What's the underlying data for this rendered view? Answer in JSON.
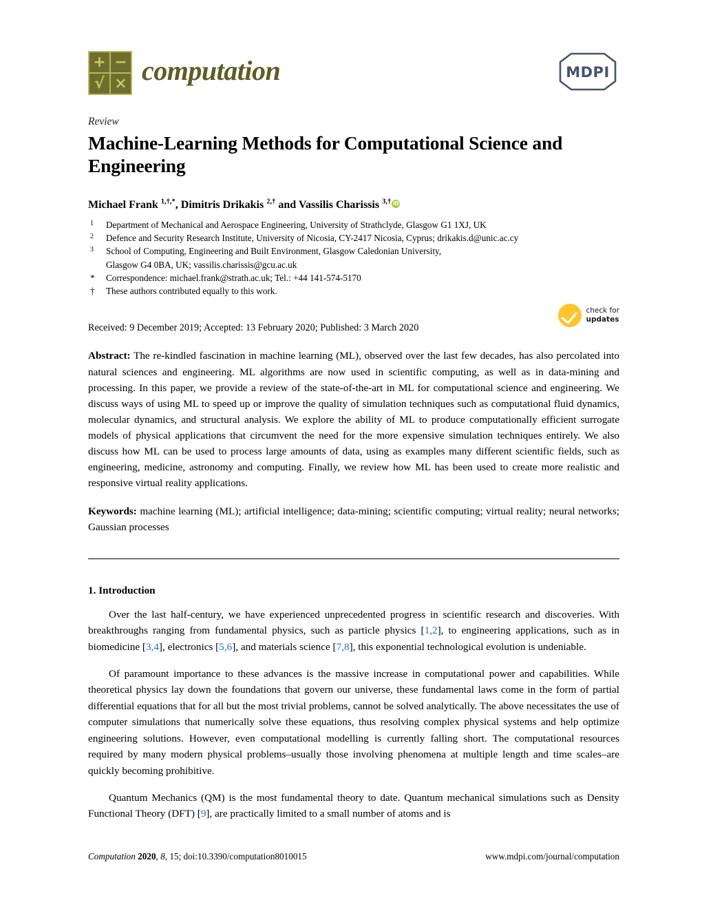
{
  "masthead": {
    "journal_name": "computation",
    "logo_cells": [
      "+",
      "−",
      "√",
      "×"
    ],
    "publisher": "MDPI"
  },
  "article": {
    "type": "Review",
    "title": "Machine-Learning Methods for Computational Science and Engineering",
    "authors_html": "Michael Frank <sup>1,†,*</sup>, Dimitris Drikakis <sup>2,†</sup> and Vassilis Charissis <sup>3,†</sup>",
    "author_names": [
      "Michael Frank",
      "Dimitris Drikakis",
      "Vassilis Charissis"
    ],
    "orcid_label": "iD"
  },
  "affiliations": [
    {
      "mark": "1",
      "text": "Department of Mechanical and Aerospace Engineering, University of Strathclyde, Glasgow G1 1XJ, UK"
    },
    {
      "mark": "2",
      "text": "Defence and Security Research Institute, University of Nicosia, CY-2417 Nicosia, Cyprus; drikakis.d@unic.ac.cy"
    },
    {
      "mark": "3",
      "text": "School of Computing, Engineering and Built Environment, Glasgow Caledonian University,",
      "continuation": "Glasgow G4 0BA, UK; vassilis.charissis@gcu.ac.uk"
    },
    {
      "mark": "*",
      "text": "Correspondence: michael.frank@strath.ac.uk; Tel.: +44 141-574-5170"
    },
    {
      "mark": "†",
      "text": "These authors contributed equally to this work."
    }
  ],
  "dates": {
    "line": "Received: 9 December 2019; Accepted: 13 February 2020; Published: 3 March 2020"
  },
  "badge": {
    "line1": "check for",
    "line2": "updates",
    "color": "#fdc42d"
  },
  "abstract": {
    "label": "Abstract:",
    "text": "The re-kindled fascination in machine learning (ML), observed over the last few decades, has also percolated into natural sciences and engineering. ML algorithms are now used in scientific computing, as well as in data-mining and processing. In this paper, we provide a review of the state-of-the-art in ML for computational science and engineering. We discuss ways of using ML to speed up or improve the quality of simulation techniques such as computational fluid dynamics, molecular dynamics, and structural analysis. We explore the ability of ML to produce computationally efficient surrogate models of physical applications that circumvent the need for the more expensive simulation techniques entirely. We also discuss how ML can be used to process large amounts of data, using as examples many different scientific fields, such as engineering, medicine, astronomy and computing. Finally, we review how ML has been used to create more realistic and responsive virtual reality applications."
  },
  "keywords": {
    "label": "Keywords:",
    "text": "machine learning (ML); artificial intelligence; data-mining; scientific computing; virtual reality; neural networks; Gaussian processes"
  },
  "body": {
    "section_heading": "1. Introduction",
    "paragraph_1_parts": [
      "Over the last half-century, we have experienced unprecedented progress in scientific research and discoveries. With breakthroughs ranging from fundamental physics, such as particle physics [",
      "1,2",
      "], to engineering applications, such as in biomedicine [",
      "3,4",
      "], electronics [",
      "5,6",
      "], and materials science [",
      "7,8",
      "], this exponential technological evolution is undeniable."
    ],
    "paragraph_2": "Of paramount importance to these advances is the massive increase in computational power and capabilities. While theoretical physics lay down the foundations that govern our universe, these fundamental laws come in the form of partial differential equations that for all but the most trivial problems, cannot be solved analytically. The above necessitates the use of computer simulations that numerically solve these equations, thus resolving complex physical systems and help optimize engineering solutions. However, even computational modelling is currently falling short. The computational resources required by many modern physical problems–usually those involving phenomena at multiple length and time scales–are quickly becoming prohibitive.",
    "paragraph_3_parts": [
      "Quantum Mechanics (QM) is the most fundamental theory to date. Quantum mechanical simulations such as Density Functional Theory (DFT) [",
      "9",
      "], are practically limited to a small number of atoms and is"
    ],
    "citation_color": "#1f6fc4"
  },
  "footer": {
    "journal": "Computation",
    "year": "2020",
    "volume": "8",
    "article_no": "15",
    "doi": "doi:10.3390/computation8010015",
    "url": "www.mdpi.com/journal/computation"
  }
}
